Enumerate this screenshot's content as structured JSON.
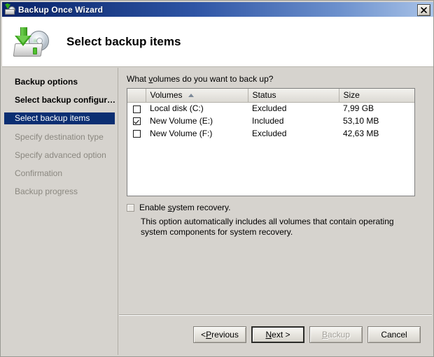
{
  "window": {
    "title": "Backup Once Wizard",
    "title_icon": "backup-disk-icon",
    "close_label": "×"
  },
  "header": {
    "title": "Select backup items",
    "icon": "backup-drive-disc-icon"
  },
  "sidebar": {
    "items": [
      {
        "label": "Backup options",
        "state": "done"
      },
      {
        "label": "Select backup configur…",
        "state": "done"
      },
      {
        "label": "Select backup items",
        "state": "current"
      },
      {
        "label": "Specify destination type",
        "state": "pending"
      },
      {
        "label": "Specify advanced option",
        "state": "pending"
      },
      {
        "label": "Confirmation",
        "state": "pending"
      },
      {
        "label": "Backup progress",
        "state": "pending"
      }
    ]
  },
  "main": {
    "question_pre": "What ",
    "question_accel": "v",
    "question_post": "olumes do you want to back up?",
    "table": {
      "columns": [
        "",
        "Volumes",
        "Status",
        "Size"
      ],
      "sort_column": "Volumes",
      "sort_direction": "ascending",
      "rows": [
        {
          "checked": false,
          "volume": "Local disk (C:)",
          "status": "Excluded",
          "size": "7,99 GB"
        },
        {
          "checked": true,
          "volume": "New Volume (E:)",
          "status": "Included",
          "size": "53,10 MB"
        },
        {
          "checked": false,
          "volume": "New Volume (F:)",
          "status": "Excluded",
          "size": "42,63 MB"
        }
      ]
    },
    "system_recovery": {
      "checked": false,
      "label_pre": "Enable ",
      "label_accel": "s",
      "label_post": "ystem recovery.",
      "description": "This option automatically includes all volumes that contain operating system components for system recovery."
    }
  },
  "footer": {
    "buttons": [
      {
        "pre": "< ",
        "accel": "P",
        "post": "revious",
        "state": "normal",
        "name": "previous-button"
      },
      {
        "pre": "",
        "accel": "N",
        "post": "ext >",
        "state": "default",
        "name": "next-button"
      },
      {
        "pre": "",
        "accel": "B",
        "post": "ackup",
        "state": "disabled",
        "name": "backup-button"
      },
      {
        "pre": "",
        "accel": "",
        "post": "Cancel",
        "state": "normal",
        "name": "cancel-button"
      }
    ]
  },
  "colors": {
    "titlebar_start": "#0a246a",
    "titlebar_end": "#a9c3e8",
    "selection": "#0b2e72",
    "face": "#d6d3ce",
    "accent_green": "#3ea520"
  }
}
